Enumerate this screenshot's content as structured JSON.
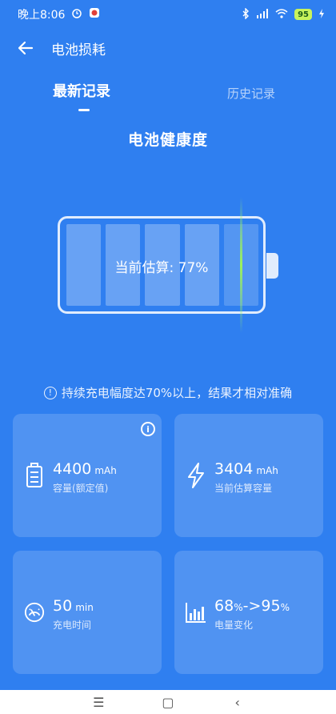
{
  "status_bar": {
    "time": "晚上8:06",
    "battery_level": "95"
  },
  "header": {
    "title": "电池损耗"
  },
  "tabs": [
    {
      "label": "最新记录",
      "active": true
    },
    {
      "label": "历史记录",
      "active": false
    }
  ],
  "section_title": "电池健康度",
  "battery": {
    "estimate_text": "当前估算: 77%",
    "estimate_fraction": 0.77,
    "colors": {
      "scan_line": "#9cf25c",
      "background": "#2f7ff0"
    }
  },
  "notice": {
    "icon_text": "!",
    "text": "持续充电幅度达70%以上，结果才相对准确"
  },
  "cards": [
    {
      "icon": "battery-icon",
      "value": "4400",
      "unit": "mAh",
      "label": "容量(额定值)",
      "has_info": true
    },
    {
      "icon": "lightning-icon",
      "value": "3404",
      "unit": "mAh",
      "label": "当前估算容量"
    },
    {
      "icon": "gauge-icon",
      "value": "50",
      "unit": "min",
      "label": "充电时间"
    },
    {
      "icon": "bar-chart-icon",
      "value_parts": [
        "68",
        "%",
        "->",
        "95",
        "%"
      ],
      "label": "电量变化"
    }
  ],
  "info_icon_text": "i",
  "nav_bar": {
    "menu_glyph": "☰",
    "home_glyph": "▢",
    "back_glyph": "‹"
  }
}
